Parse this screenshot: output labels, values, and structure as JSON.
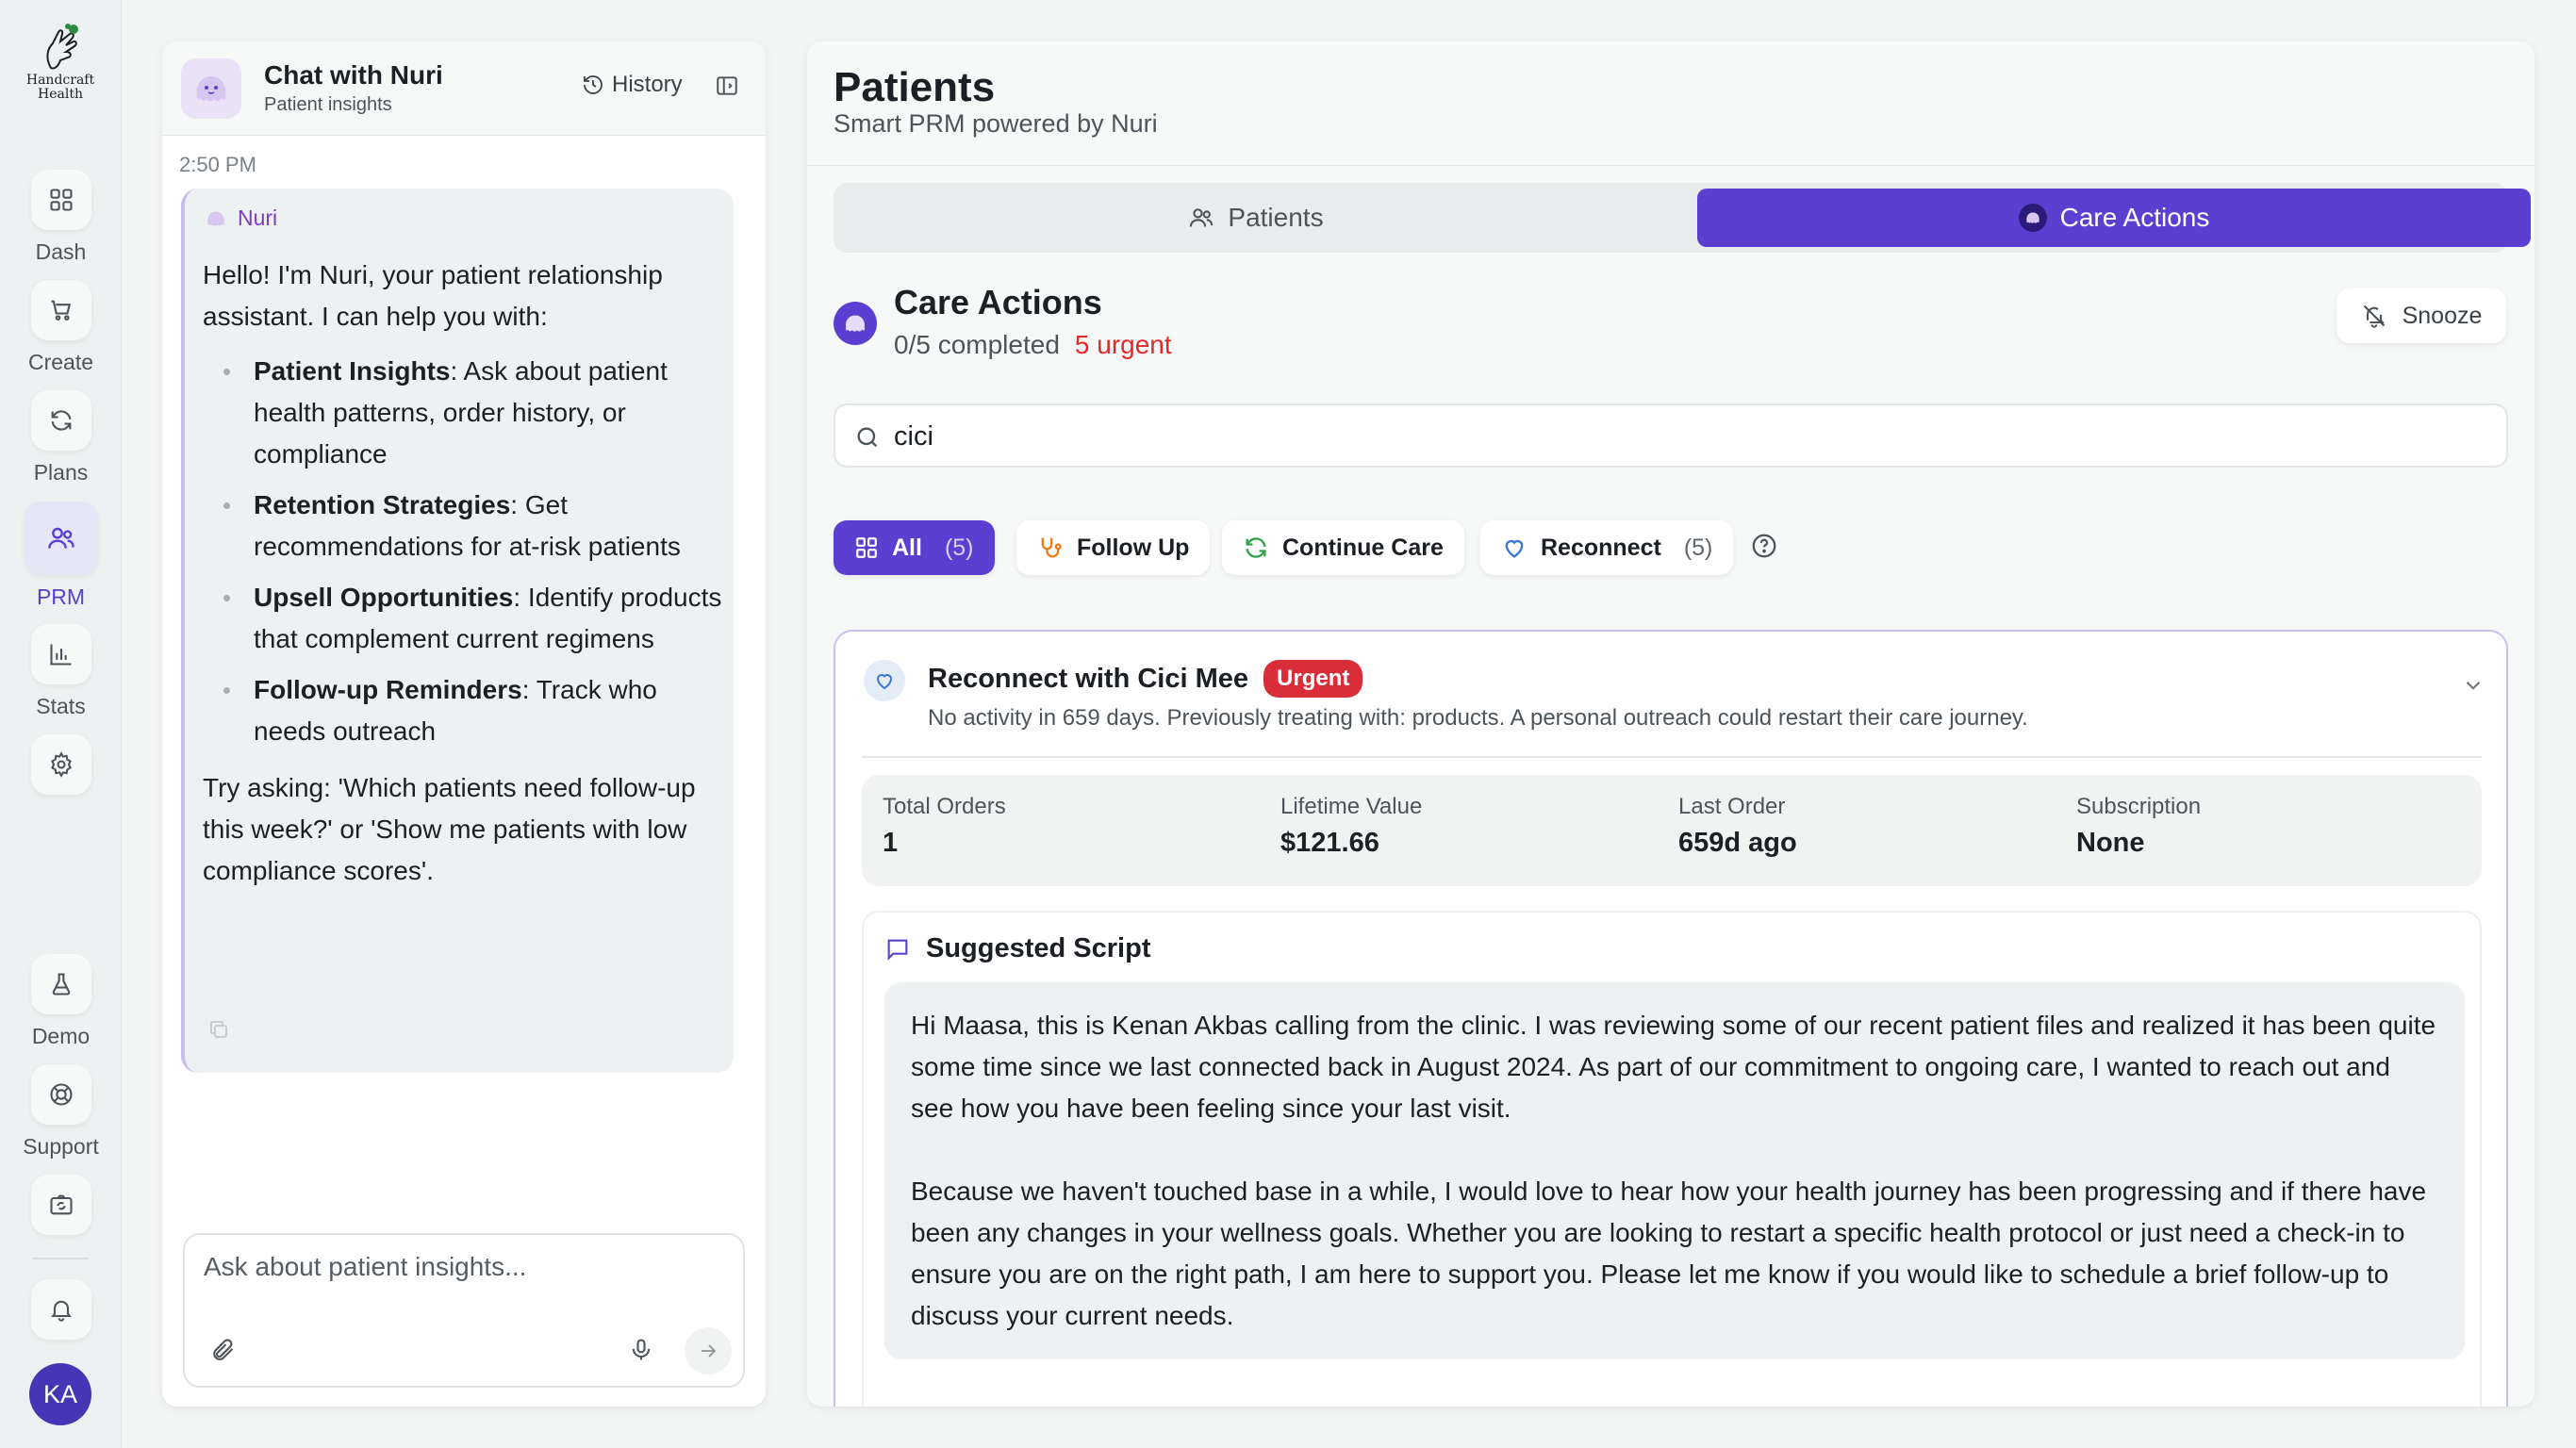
{
  "brand": {
    "logo_text_line1": "Handcraft",
    "logo_text_line2": "Health"
  },
  "rail": {
    "items": [
      {
        "label": "Dash",
        "icon": "grid-icon"
      },
      {
        "label": "Create",
        "icon": "cart-icon"
      },
      {
        "label": "Plans",
        "icon": "refresh-icon"
      },
      {
        "label": "PRM",
        "icon": "users-icon",
        "active": true
      },
      {
        "label": "Stats",
        "icon": "bar-chart-icon"
      },
      {
        "label": "",
        "icon": "gear-icon"
      }
    ],
    "bottom_items": [
      {
        "label": "Demo",
        "icon": "flask-icon"
      },
      {
        "label": "Support",
        "icon": "lifebuoy-icon"
      },
      {
        "label": "",
        "icon": "camera-switch-icon"
      },
      {
        "label": "",
        "icon": "bell-icon"
      }
    ],
    "avatar_initials": "KA",
    "accent": "#5b3fd1"
  },
  "chat": {
    "title": "Chat with Nuri",
    "subtitle": "Patient insights",
    "history_label": "History",
    "time": "2:50 PM",
    "sender": "Nuri",
    "intro": "Hello! I'm Nuri, your patient relationship assistant. I can help you with:",
    "bullets": [
      {
        "title": "Patient Insights",
        "text": ": Ask about patient health patterns, order history, or compliance"
      },
      {
        "title": "Retention Strategies",
        "text": ": Get recommendations for at-risk patients"
      },
      {
        "title": "Upsell Opportunities",
        "text": ": Identify products that complement current regimens"
      },
      {
        "title": "Follow-up Reminders",
        "text": ": Track who needs outreach"
      }
    ],
    "outro": "Try asking: 'Which patients need follow-up this week?' or 'Show me patients with low compliance scores'.",
    "input_placeholder": "Ask about patient insights...",
    "input_value": ""
  },
  "main": {
    "title": "Patients",
    "subtitle": "Smart PRM powered by Nuri",
    "tabs": [
      {
        "label": "Patients",
        "active": false
      },
      {
        "label": "Care Actions",
        "active": true
      }
    ],
    "care_actions": {
      "title": "Care Actions",
      "progress": "0/5 completed",
      "urgent": "5 urgent",
      "snooze_label": "Snooze",
      "search_value": "cici",
      "filters": [
        {
          "label": "All",
          "count": "(5)",
          "active": true,
          "icon": "grid-icon"
        },
        {
          "label": "Follow Up",
          "count": "",
          "active": false,
          "icon": "stethoscope-icon"
        },
        {
          "label": "Continue Care",
          "count": "",
          "active": false,
          "icon": "refresh-icon"
        },
        {
          "label": "Reconnect",
          "count": "(5)",
          "active": false,
          "icon": "heart-icon"
        }
      ],
      "card": {
        "title": "Reconnect with Cici Mee",
        "badge": "Urgent",
        "description": "No activity in 659 days. Previously treating with: products. A personal outreach could restart their care journey.",
        "stats": [
          {
            "label": "Total Orders",
            "value": "1"
          },
          {
            "label": "Lifetime Value",
            "value": "$121.66"
          },
          {
            "label": "Last Order",
            "value": "659d ago"
          },
          {
            "label": "Subscription",
            "value": "None"
          }
        ],
        "script_title": "Suggested Script",
        "script_paragraphs": [
          "Hi Maasa, this is Kenan Akbas calling from the clinic. I was reviewing some of our recent patient files and realized it has been quite some time since we last connected back in August 2024. As part of our commitment to ongoing care, I wanted to reach out and see how you have been feeling since your last visit.",
          "Because we haven't touched base in a while, I would love to hear how your health journey has been progressing and if there have been any changes in your wellness goals. Whether you are looking to restart a specific health protocol or just need a check-in to ensure you are on the right path, I am here to support you. Please let me know if you would like to schedule a brief follow-up to discuss your current needs."
        ]
      }
    }
  },
  "colors": {
    "accent": "#5b3fd1",
    "urgent": "#d92d3a",
    "urgent_text": "#e02a2a"
  }
}
